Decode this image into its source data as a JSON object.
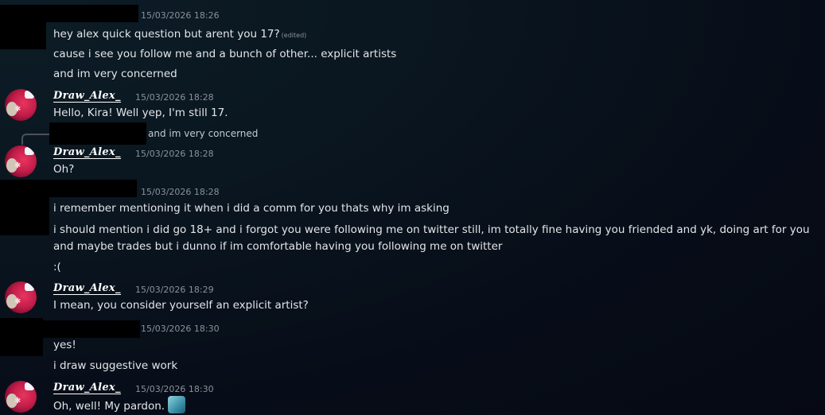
{
  "messages": [
    {
      "author_redacted": true,
      "timestamp": "15/03/2026 18:26",
      "lines": [
        "hey alex quick question but arent you 17?",
        "cause i see you follow me and a bunch of other... explicit artists",
        "and im very concerned"
      ],
      "edited_label": "(edited)"
    },
    {
      "author": "Draw_Alex_",
      "timestamp": "15/03/2026 18:28",
      "lines": [
        "Hello, Kira! Well yep, I'm still 17."
      ]
    },
    {
      "author": "Draw_Alex_",
      "timestamp": "15/03/2026 18:28",
      "reply_to": "and im very concerned",
      "lines": [
        "Oh?"
      ]
    },
    {
      "author_redacted": true,
      "timestamp": "15/03/2026 18:28",
      "lines": [
        "i remember mentioning it when i did a comm for you thats why im asking",
        "i should mention i did go 18+ and i forgot you were following me on twitter still, im totally fine having you friended and yk, doing art for you and maybe trades but i dunno if im comfortable having you following me on twitter",
        ":("
      ]
    },
    {
      "author": "Draw_Alex_",
      "timestamp": "15/03/2026 18:29",
      "lines": [
        "I mean, you consider yourself an explicit artist?"
      ]
    },
    {
      "author_redacted": true,
      "timestamp": "15/03/2026 18:30",
      "lines": [
        "yes!",
        "i draw suggestive work"
      ]
    },
    {
      "author": "Draw_Alex_",
      "timestamp": "15/03/2026 18:30",
      "lines": [
        "Oh, well! My pardon."
      ],
      "emoji": "custom-emoji-icon"
    }
  ]
}
